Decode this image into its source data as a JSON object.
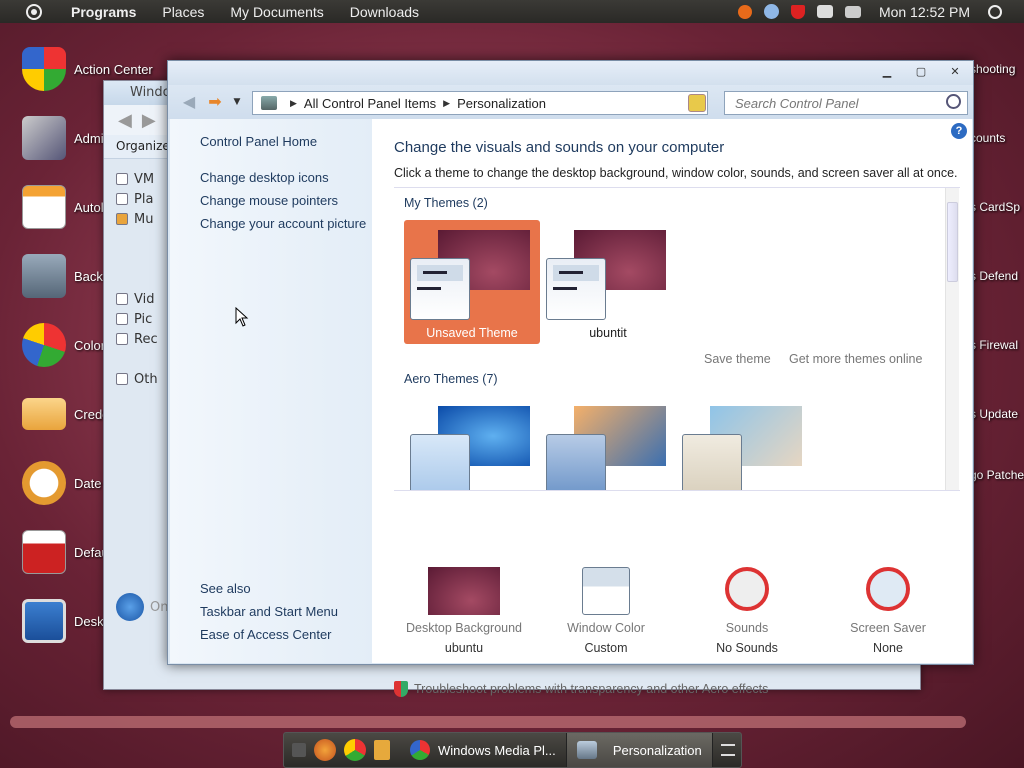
{
  "top_panel": {
    "menus": [
      "Programs",
      "Places",
      "My Documents",
      "Downloads"
    ],
    "clock": "Mon 12:52 PM"
  },
  "desktop": {
    "left_icons": [
      "Action Center",
      "Admi",
      "Autol",
      "Backu",
      "Color",
      "Crede",
      "Date",
      "Defau",
      "Deskt"
    ],
    "right_labels": [
      "shooting",
      "counts",
      "s CardSp",
      "s Defend",
      "s Firewal",
      "s Update",
      "go Patche"
    ]
  },
  "back_window": {
    "title": "Windo",
    "organize": "Organize",
    "library": [
      "VM",
      "Pla",
      "Mu",
      "Vid",
      "Pic",
      "Rec",
      "Oth"
    ],
    "status": "On"
  },
  "window": {
    "address": [
      "All Control Panel Items",
      "Personalization"
    ],
    "search_placeholder": "Search Control Panel"
  },
  "left_pane": {
    "home": "Control Panel Home",
    "links": [
      "Change desktop icons",
      "Change mouse pointers",
      "Change your account picture"
    ],
    "see_also": "See also",
    "see_also_links": [
      "Taskbar and Start Menu",
      "Ease of Access Center"
    ]
  },
  "content": {
    "heading": "Change the visuals and sounds on your computer",
    "subheading": "Click a theme to change the desktop background, window color, sounds, and screen saver all at once.",
    "my_themes_label": "My Themes (2)",
    "my_themes": [
      "Unsaved Theme",
      "ubuntit"
    ],
    "save_theme": "Save theme",
    "get_more": "Get more themes online",
    "aero_label": "Aero Themes (7)",
    "bottom": [
      {
        "label": "Desktop Background",
        "value": "ubuntu"
      },
      {
        "label": "Window Color",
        "value": "Custom"
      },
      {
        "label": "Sounds",
        "value": "No Sounds"
      },
      {
        "label": "Screen Saver",
        "value": "None"
      }
    ],
    "troubleshoot": "Troubleshoot problems with transparency and other Aero effects"
  },
  "taskbar": {
    "tasks": [
      "Windows Media Pl...",
      "Personalization"
    ]
  },
  "colors": {
    "selected_theme": "#e8744a",
    "link_blue": "#1e3a5e"
  }
}
